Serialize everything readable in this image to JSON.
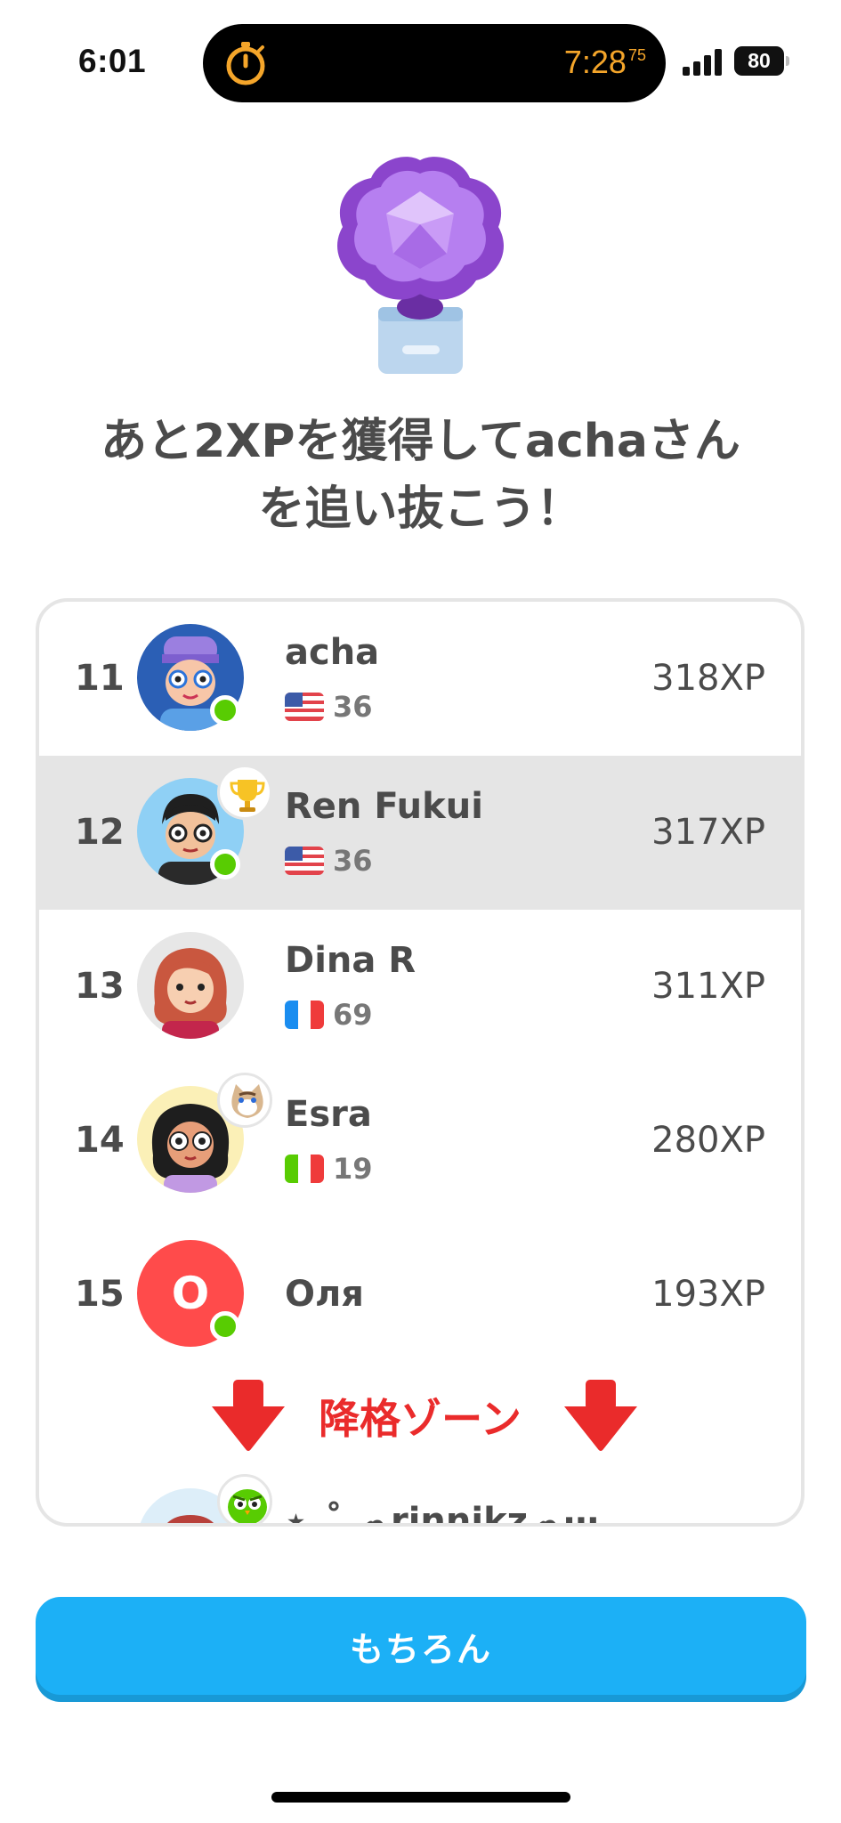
{
  "status_bar": {
    "time": "6:01",
    "timer": "7:28",
    "timer_fraction": "75",
    "battery": "80",
    "timer_color": "#f4a52a"
  },
  "headline": {
    "line1": "あと2XPを獲得してachaさん",
    "line2": "を追い抜こう！"
  },
  "leaderboard": {
    "rows": [
      {
        "rank": "11",
        "name": "acha",
        "flag": "us-flag-icon",
        "streak": "36",
        "xp": "318XP",
        "online": true
      },
      {
        "rank": "12",
        "name": "Ren Fukui",
        "flag": "us-flag-icon",
        "streak": "36",
        "xp": "317XP",
        "online": true,
        "highlight": true,
        "badge": "trophy-icon"
      },
      {
        "rank": "13",
        "name": "Dina R",
        "flag": "fr-flag-icon",
        "streak": "69",
        "xp": "311XP"
      },
      {
        "rank": "14",
        "name": "Esra",
        "flag": "it-flag-icon",
        "streak": "19",
        "xp": "280XP",
        "badge": "cat-icon"
      },
      {
        "rank": "15",
        "name": "Оля",
        "avatar_letter": "O",
        "xp": "193XP",
        "online": true
      }
    ],
    "demotion_label": "降格ゾーン",
    "partial_row_name": "⋆｡˚ ☁rinnikz☁⋯"
  },
  "primary_button": {
    "label": "もちろん"
  },
  "colors": {
    "primary": "#1cb0f6",
    "danger": "#ea2b2b",
    "online": "#58cc02",
    "highlight": "#e5e5e5",
    "league": "#9b5fd6"
  }
}
